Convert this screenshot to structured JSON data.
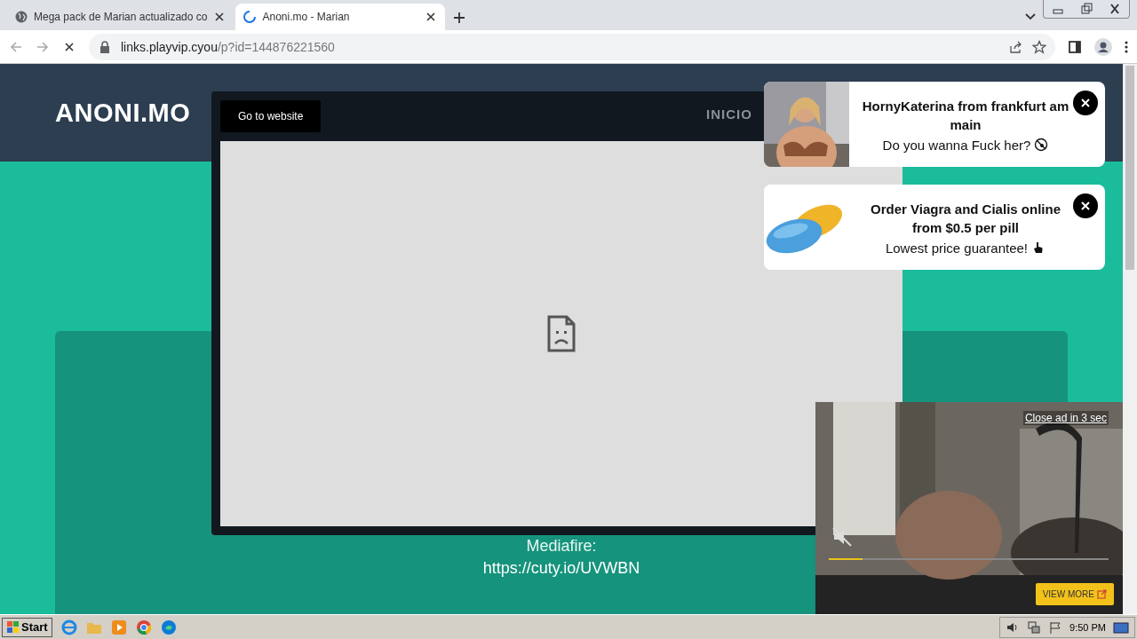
{
  "browser": {
    "tabs": [
      {
        "title": "Mega pack de Marian actualizado co",
        "selected": false,
        "loading": false
      },
      {
        "title": "Anoni.mo - Marian",
        "selected": true,
        "loading": true
      }
    ],
    "address": {
      "host": "links.playvip.cyou",
      "path": "/p?id=144876221560"
    }
  },
  "site": {
    "logo": "ANONI.MO",
    "nav": [
      "INICIO"
    ],
    "card": {
      "label": "Mediafire:",
      "link": "https://cuty.io/UVWBN"
    }
  },
  "modal": {
    "button": "Go to website"
  },
  "notifications": [
    {
      "title": "HornyKaterina from frankfurt am main",
      "text": "Do you wanna Fuck her?"
    },
    {
      "kind": "pills",
      "title": "Order Viagra and Cialis online from $0.5 per pill",
      "text": "Lowest price guarantee!"
    }
  ],
  "video_ad": {
    "close": "Close ad in 3 sec",
    "button": "VIEW MORE",
    "muted": true,
    "level": 0.12
  },
  "taskbar": {
    "start": "Start",
    "clock": "9:50 PM"
  }
}
